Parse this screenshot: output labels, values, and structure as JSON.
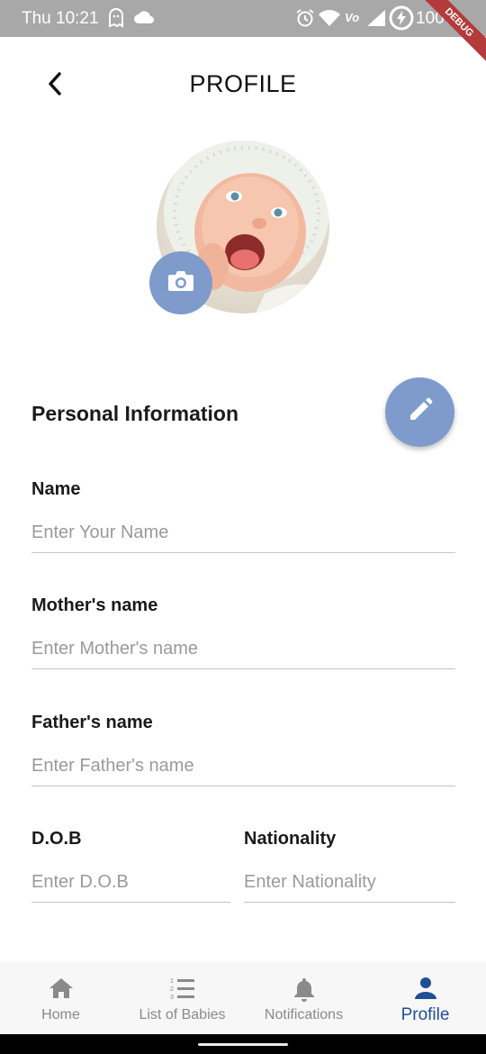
{
  "status_bar": {
    "time": "Thu 10:21",
    "battery": "100%",
    "debug_label": "DEBUG",
    "icons": [
      "ghost-icon",
      "cloud-icon",
      "alarm-icon",
      "wifi-icon",
      "volte-icon",
      "signal-icon",
      "battery-charging-icon"
    ]
  },
  "header": {
    "title": "PROFILE",
    "back_icon": "chevron-left-icon"
  },
  "avatar": {
    "camera_icon": "camera-icon"
  },
  "section": {
    "title": "Personal Information",
    "edit_icon": "pencil-icon"
  },
  "fields": {
    "name": {
      "label": "Name",
      "placeholder": "Enter Your Name",
      "value": ""
    },
    "mother": {
      "label": "Mother's name",
      "placeholder": "Enter Mother's name",
      "value": ""
    },
    "father": {
      "label": "Father's name",
      "placeholder": "Enter Father's name",
      "value": ""
    },
    "dob": {
      "label": "D.O.B",
      "placeholder": "Enter D.O.B",
      "value": ""
    },
    "nationality": {
      "label": "Nationality",
      "placeholder": "Enter Nationality",
      "value": ""
    }
  },
  "bottom_nav": {
    "items": [
      {
        "label": "Home",
        "icon": "home-icon"
      },
      {
        "label": "List of Babies",
        "icon": "list-numbered-icon"
      },
      {
        "label": "Notifications",
        "icon": "bell-icon"
      },
      {
        "label": "Profile",
        "icon": "person-icon"
      }
    ],
    "active_index": 3
  },
  "colors": {
    "accent": "#7f9bcb",
    "active_nav": "#1f4f95",
    "status_bar": "#a8a8a8",
    "inactive_nav": "#8a8a8a"
  }
}
